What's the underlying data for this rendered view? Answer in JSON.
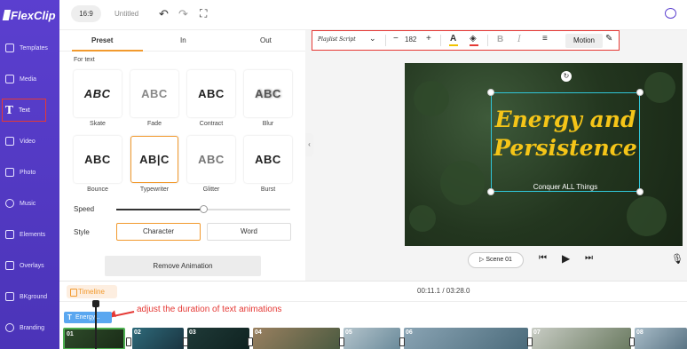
{
  "app": {
    "logo": "FlexClip"
  },
  "topbar": {
    "ratio": "16:9",
    "title": "Untitled"
  },
  "sidebar": {
    "items": [
      {
        "label": "Templates",
        "icon": "templates-icon"
      },
      {
        "label": "Media",
        "icon": "media-icon"
      },
      {
        "label": "Text",
        "icon": "text-icon"
      },
      {
        "label": "Video",
        "icon": "video-icon"
      },
      {
        "label": "Photo",
        "icon": "photo-icon"
      },
      {
        "label": "Music",
        "icon": "music-icon"
      },
      {
        "label": "Elements",
        "icon": "elements-icon"
      },
      {
        "label": "Overlays",
        "icon": "overlays-icon"
      },
      {
        "label": "BKground",
        "icon": "background-icon"
      },
      {
        "label": "Branding",
        "icon": "branding-icon"
      }
    ],
    "active": "Text"
  },
  "panel": {
    "tabs": [
      "Preset",
      "In",
      "Out"
    ],
    "active_tab": "Preset",
    "section_title": "For text",
    "presets": [
      {
        "label": "Skate",
        "sample": "ABC"
      },
      {
        "label": "Fade",
        "sample": "ABC"
      },
      {
        "label": "Contract",
        "sample": "ABC"
      },
      {
        "label": "Blur",
        "sample": "ABC"
      },
      {
        "label": "Bounce",
        "sample": "ABC"
      },
      {
        "label": "Typewriter",
        "sample": "AB|C"
      },
      {
        "label": "Glitter",
        "sample": "ABC"
      },
      {
        "label": "Burst",
        "sample": "ABC"
      }
    ],
    "selected_preset": "Typewriter",
    "speed_label": "Speed",
    "speed_value": 0.5,
    "style_label": "Style",
    "style_options": [
      "Character",
      "Word"
    ],
    "style_selected": "Character",
    "remove_button": "Remove Animation"
  },
  "text_toolbar": {
    "font": "Playlist Script",
    "size": "182",
    "minus": "−",
    "plus": "+",
    "bold": "B",
    "italic": "I",
    "motion": "Motion",
    "text_color": "#f2c200",
    "highlight_color": "#e53935"
  },
  "canvas": {
    "headline": "Energy and Persistence",
    "subline": "Conquer ALL Things",
    "headline_color": "#f5c518",
    "selection_color": "#30c6d8"
  },
  "player": {
    "scene": "Scene 01"
  },
  "timeline": {
    "label": "Timeline",
    "time": "00:11.1 / 03:28.0",
    "annotation": "adjust the duration of text animations",
    "text_chip": "Energy...",
    "clips": [
      "01",
      "02",
      "03",
      "04",
      "05",
      "06",
      "07",
      "08"
    ]
  },
  "colors": {
    "accent": "#f29a2e",
    "sidebar": "#5b3fcf",
    "annotation": "#e53935"
  }
}
